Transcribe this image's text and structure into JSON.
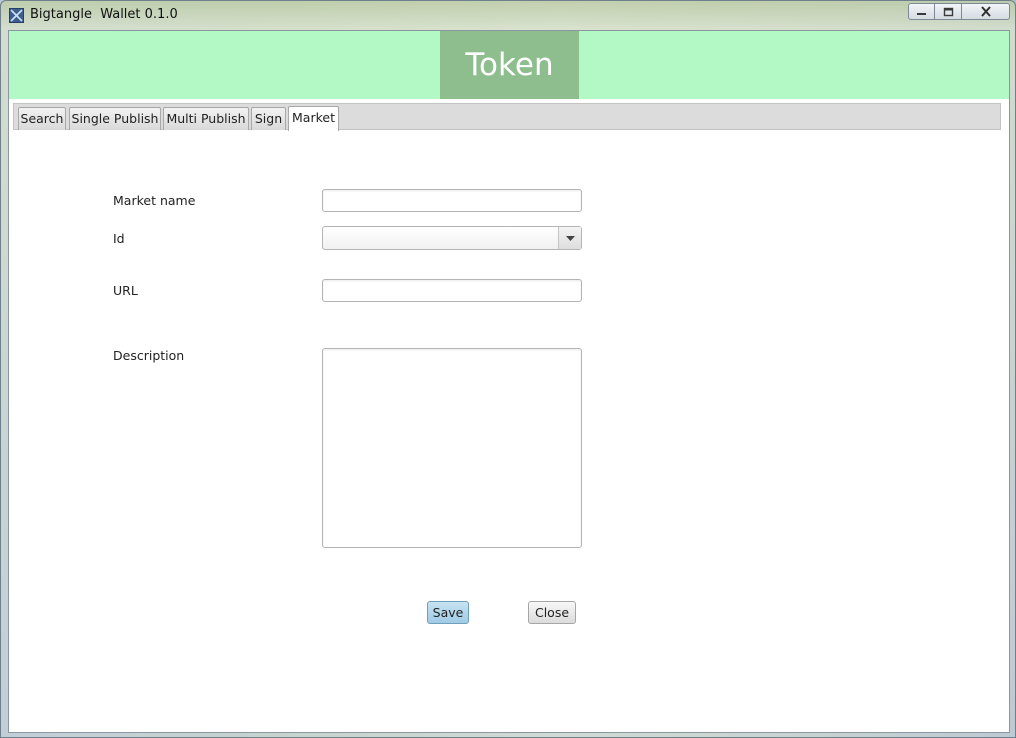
{
  "window": {
    "title": "Bigtangle  Wallet 0.1.0",
    "controls": {
      "minimize": "minimize-icon",
      "maximize": "maximize-icon",
      "close": "close-icon"
    }
  },
  "header": {
    "title": "Token",
    "band_color": "#b3f9c6",
    "title_bg": "#8ebd8e"
  },
  "tabs": [
    {
      "label": "Search"
    },
    {
      "label": "Single Publish"
    },
    {
      "label": "Multi Publish"
    },
    {
      "label": "Sign"
    },
    {
      "label": "Market",
      "active": true
    }
  ],
  "form": {
    "market_name": {
      "label": "Market name",
      "value": ""
    },
    "id": {
      "label": "Id",
      "value": ""
    },
    "url": {
      "label": "URL",
      "value": ""
    },
    "description": {
      "label": "Description",
      "value": ""
    }
  },
  "buttons": {
    "save": "Save",
    "close": "Close"
  }
}
